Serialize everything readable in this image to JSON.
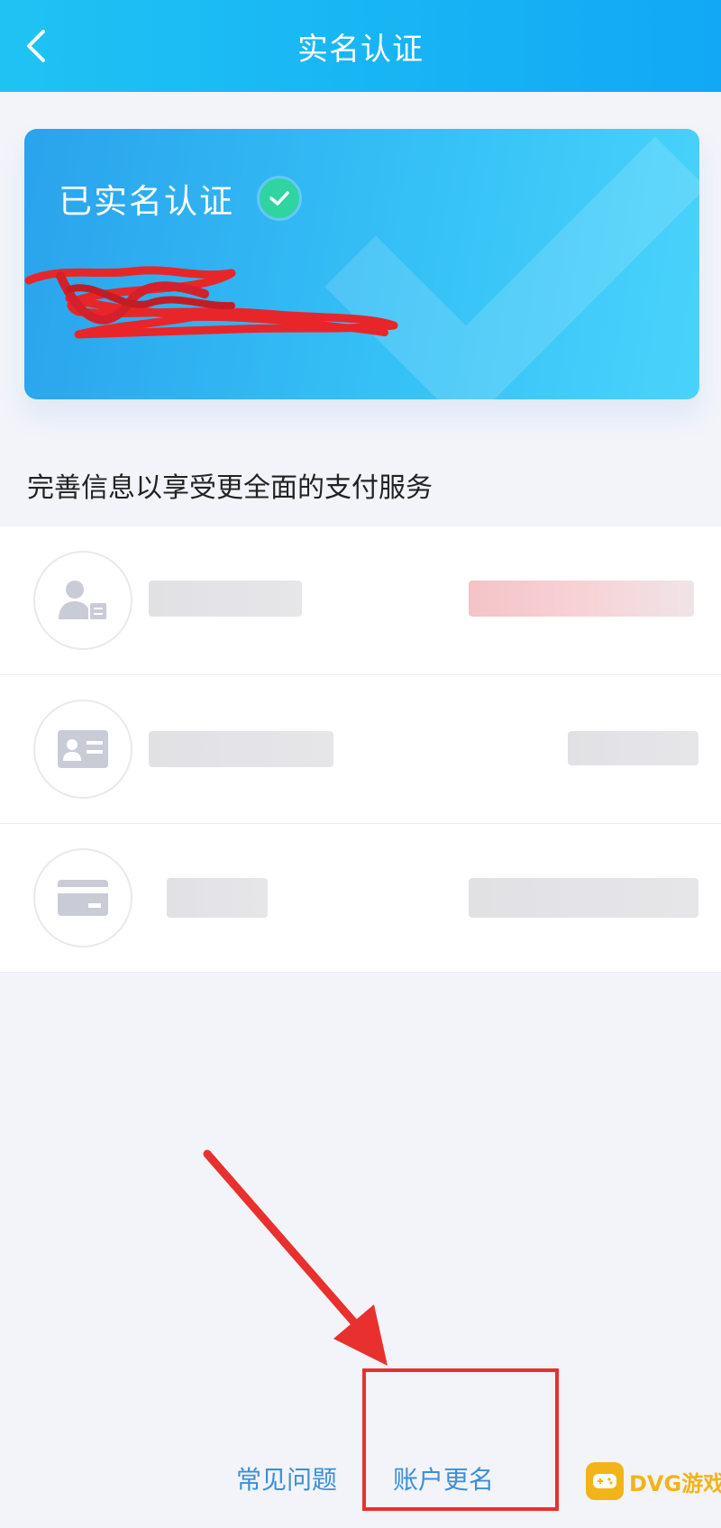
{
  "header": {
    "title": "实名认证"
  },
  "card": {
    "title": "已实名认证"
  },
  "hint": "完善信息以享受更全面的支付服务",
  "list": {
    "items": [
      {
        "label": "",
        "icon": "person-id-icon"
      },
      {
        "label": "",
        "icon": "id-card-icon"
      },
      {
        "label": "",
        "icon": "bank-card-icon"
      }
    ]
  },
  "bottom": {
    "faq_label": "常见问题",
    "rename_label": "账户更名"
  },
  "watermark": {
    "text": "DVG游戏网"
  },
  "colors": {
    "header_start": "#1fc3f3",
    "header_end": "#12a8f5",
    "check_green": "#2fd4a0",
    "link_blue": "#3c8fd8",
    "annotation_red": "#e8312f"
  }
}
